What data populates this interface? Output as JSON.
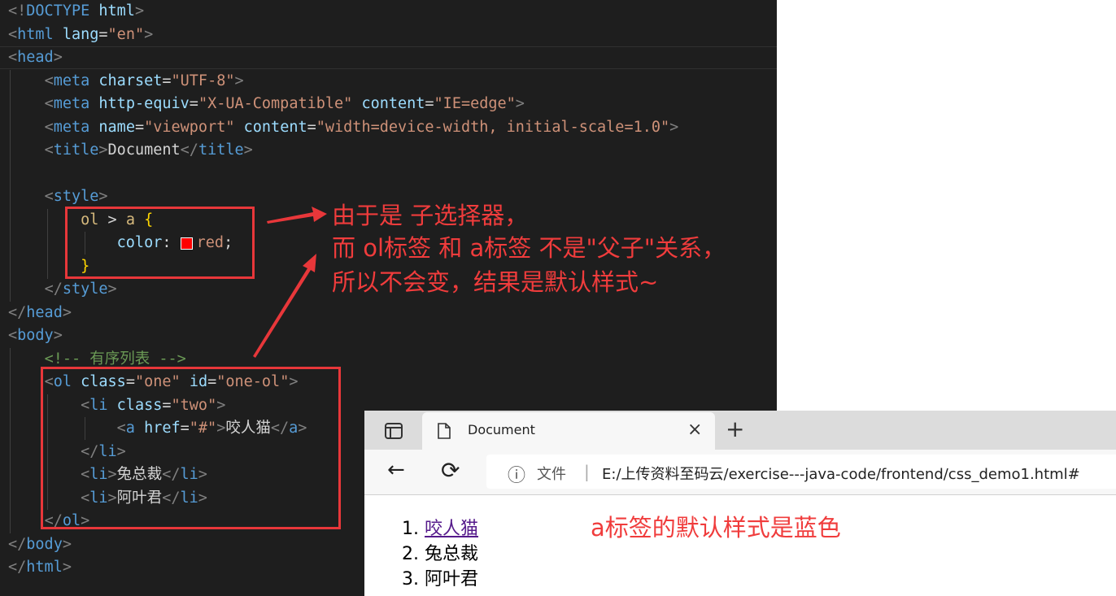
{
  "editor": {
    "lines": [
      [
        {
          "c": "p",
          "t": "<!"
        },
        {
          "c": "t",
          "t": "DOCTYPE"
        },
        {
          "c": "tx",
          "t": " "
        },
        {
          "c": "a",
          "t": "html"
        },
        {
          "c": "p",
          "t": ">"
        }
      ],
      [
        {
          "c": "p",
          "t": "<"
        },
        {
          "c": "t",
          "t": "html"
        },
        {
          "c": "tx",
          "t": " "
        },
        {
          "c": "a",
          "t": "lang"
        },
        {
          "c": "tx",
          "t": "="
        },
        {
          "c": "s",
          "t": "\"en\""
        },
        {
          "c": "p",
          "t": ">"
        }
      ],
      [
        {
          "c": "p",
          "t": "<"
        },
        {
          "c": "t",
          "t": "head"
        },
        {
          "c": "p",
          "t": ">"
        }
      ],
      [
        {
          "c": "tx",
          "t": "    "
        },
        {
          "c": "p",
          "t": "<"
        },
        {
          "c": "t",
          "t": "meta"
        },
        {
          "c": "tx",
          "t": " "
        },
        {
          "c": "a",
          "t": "charset"
        },
        {
          "c": "tx",
          "t": "="
        },
        {
          "c": "s",
          "t": "\"UTF-8\""
        },
        {
          "c": "p",
          "t": ">"
        }
      ],
      [
        {
          "c": "tx",
          "t": "    "
        },
        {
          "c": "p",
          "t": "<"
        },
        {
          "c": "t",
          "t": "meta"
        },
        {
          "c": "tx",
          "t": " "
        },
        {
          "c": "a",
          "t": "http-equiv"
        },
        {
          "c": "tx",
          "t": "="
        },
        {
          "c": "s",
          "t": "\"X-UA-Compatible\""
        },
        {
          "c": "tx",
          "t": " "
        },
        {
          "c": "a",
          "t": "content"
        },
        {
          "c": "tx",
          "t": "="
        },
        {
          "c": "s",
          "t": "\"IE=edge\""
        },
        {
          "c": "p",
          "t": ">"
        }
      ],
      [
        {
          "c": "tx",
          "t": "    "
        },
        {
          "c": "p",
          "t": "<"
        },
        {
          "c": "t",
          "t": "meta"
        },
        {
          "c": "tx",
          "t": " "
        },
        {
          "c": "a",
          "t": "name"
        },
        {
          "c": "tx",
          "t": "="
        },
        {
          "c": "s",
          "t": "\"viewport\""
        },
        {
          "c": "tx",
          "t": " "
        },
        {
          "c": "a",
          "t": "content"
        },
        {
          "c": "tx",
          "t": "="
        },
        {
          "c": "s",
          "t": "\"width=device-width, initial-scale=1.0\""
        },
        {
          "c": "p",
          "t": ">"
        }
      ],
      [
        {
          "c": "tx",
          "t": "    "
        },
        {
          "c": "p",
          "t": "<"
        },
        {
          "c": "t",
          "t": "title"
        },
        {
          "c": "p",
          "t": ">"
        },
        {
          "c": "tx",
          "t": "Document"
        },
        {
          "c": "p",
          "t": "</"
        },
        {
          "c": "t",
          "t": "title"
        },
        {
          "c": "p",
          "t": ">"
        }
      ],
      [],
      [
        {
          "c": "tx",
          "t": "    "
        },
        {
          "c": "p",
          "t": "<"
        },
        {
          "c": "t",
          "t": "style"
        },
        {
          "c": "p",
          "t": ">"
        }
      ],
      [
        {
          "c": "tx",
          "t": "        "
        },
        {
          "c": "sel",
          "t": "ol"
        },
        {
          "c": "tx",
          "t": " > "
        },
        {
          "c": "sel",
          "t": "a"
        },
        {
          "c": "tx",
          "t": " "
        },
        {
          "c": "br",
          "t": "{"
        }
      ],
      [
        {
          "c": "tx",
          "t": "            "
        },
        {
          "c": "a",
          "t": "color"
        },
        {
          "c": "tx",
          "t": ": "
        },
        {
          "c": "sw",
          "t": ""
        },
        {
          "c": "s",
          "t": "red"
        },
        {
          "c": "tx",
          "t": ";"
        }
      ],
      [
        {
          "c": "tx",
          "t": "        "
        },
        {
          "c": "br",
          "t": "}"
        }
      ],
      [
        {
          "c": "tx",
          "t": "    "
        },
        {
          "c": "p",
          "t": "</"
        },
        {
          "c": "t",
          "t": "style"
        },
        {
          "c": "p",
          "t": ">"
        }
      ],
      [
        {
          "c": "p",
          "t": "</"
        },
        {
          "c": "t",
          "t": "head"
        },
        {
          "c": "p",
          "t": ">"
        }
      ],
      [
        {
          "c": "p",
          "t": "<"
        },
        {
          "c": "t",
          "t": "body"
        },
        {
          "c": "p",
          "t": ">"
        }
      ],
      [
        {
          "c": "tx",
          "t": "    "
        },
        {
          "c": "c",
          "t": "<!-- 有序列表 -->"
        }
      ],
      [
        {
          "c": "tx",
          "t": "    "
        },
        {
          "c": "p",
          "t": "<"
        },
        {
          "c": "t",
          "t": "ol"
        },
        {
          "c": "tx",
          "t": " "
        },
        {
          "c": "a",
          "t": "class"
        },
        {
          "c": "tx",
          "t": "="
        },
        {
          "c": "s",
          "t": "\"one\""
        },
        {
          "c": "tx",
          "t": " "
        },
        {
          "c": "a",
          "t": "id"
        },
        {
          "c": "tx",
          "t": "="
        },
        {
          "c": "s",
          "t": "\"one-ol\""
        },
        {
          "c": "p",
          "t": ">"
        }
      ],
      [
        {
          "c": "tx",
          "t": "        "
        },
        {
          "c": "p",
          "t": "<"
        },
        {
          "c": "t",
          "t": "li"
        },
        {
          "c": "tx",
          "t": " "
        },
        {
          "c": "a",
          "t": "class"
        },
        {
          "c": "tx",
          "t": "="
        },
        {
          "c": "s",
          "t": "\"two\""
        },
        {
          "c": "p",
          "t": ">"
        }
      ],
      [
        {
          "c": "tx",
          "t": "            "
        },
        {
          "c": "p",
          "t": "<"
        },
        {
          "c": "t",
          "t": "a"
        },
        {
          "c": "tx",
          "t": " "
        },
        {
          "c": "a",
          "t": "href"
        },
        {
          "c": "tx",
          "t": "="
        },
        {
          "c": "s",
          "t": "\"#\""
        },
        {
          "c": "p",
          "t": ">"
        },
        {
          "c": "tx",
          "t": "咬人猫"
        },
        {
          "c": "p",
          "t": "</"
        },
        {
          "c": "t",
          "t": "a"
        },
        {
          "c": "p",
          "t": ">"
        }
      ],
      [
        {
          "c": "tx",
          "t": "        "
        },
        {
          "c": "p",
          "t": "</"
        },
        {
          "c": "t",
          "t": "li"
        },
        {
          "c": "p",
          "t": ">"
        }
      ],
      [
        {
          "c": "tx",
          "t": "        "
        },
        {
          "c": "p",
          "t": "<"
        },
        {
          "c": "t",
          "t": "li"
        },
        {
          "c": "p",
          "t": ">"
        },
        {
          "c": "tx",
          "t": "兔总裁"
        },
        {
          "c": "p",
          "t": "</"
        },
        {
          "c": "t",
          "t": "li"
        },
        {
          "c": "p",
          "t": ">"
        }
      ],
      [
        {
          "c": "tx",
          "t": "        "
        },
        {
          "c": "p",
          "t": "<"
        },
        {
          "c": "t",
          "t": "li"
        },
        {
          "c": "p",
          "t": ">"
        },
        {
          "c": "tx",
          "t": "阿叶君"
        },
        {
          "c": "p",
          "t": "</"
        },
        {
          "c": "t",
          "t": "li"
        },
        {
          "c": "p",
          "t": ">"
        }
      ],
      [
        {
          "c": "tx",
          "t": "    "
        },
        {
          "c": "p",
          "t": "</"
        },
        {
          "c": "t",
          "t": "ol"
        },
        {
          "c": "p",
          "t": ">"
        }
      ],
      [
        {
          "c": "p",
          "t": "</"
        },
        {
          "c": "t",
          "t": "body"
        },
        {
          "c": "p",
          "t": ">"
        }
      ],
      [
        {
          "c": "p",
          "t": "</"
        },
        {
          "c": "t",
          "t": "html"
        },
        {
          "c": "p",
          "t": ">"
        }
      ]
    ]
  },
  "annotations": {
    "note1_line1": "由于是 子选择器，",
    "note1_line2": "而 ol标签 和 a标签 不是\"父子\"关系，",
    "note1_line3": "所以不会变，结果是默认样式~",
    "note2": "a标签的默认样式是蓝色"
  },
  "browser": {
    "tab_title": "Document",
    "tab_close": "×",
    "new_tab": "+",
    "back": "←",
    "refresh": "⟳",
    "info_glyph": "ⓘ",
    "addr_label": "文件",
    "addr_sep": "|",
    "url": "E:/上传资料至码云/exercise---java-code/frontend/css_demo1.html#",
    "list": [
      {
        "num": "1.",
        "text": "咬人猫",
        "link": true
      },
      {
        "num": "2.",
        "text": "兔总裁",
        "link": false
      },
      {
        "num": "3.",
        "text": "阿叶君",
        "link": false
      }
    ]
  },
  "colors": {
    "editor_bg": "#1e1e1e",
    "annotation": "#f03c3c",
    "swatch": "#ff0000",
    "visited_link": "#551a8b"
  },
  "icons": [
    "tab-actions-icon",
    "page-icon",
    "close-icon",
    "plus-icon",
    "back-arrow-icon",
    "refresh-icon",
    "info-icon"
  ]
}
